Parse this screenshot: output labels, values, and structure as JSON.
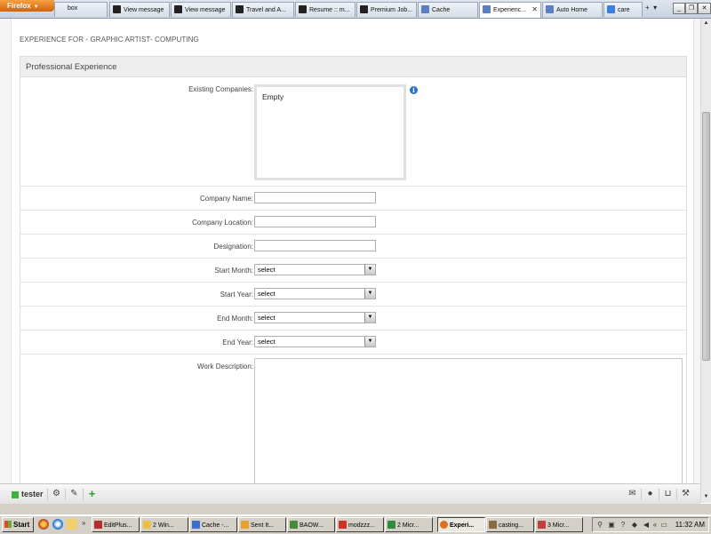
{
  "browser": {
    "menu_button": "Firefox",
    "tabs": [
      {
        "label": "box",
        "icon": "mail-icon",
        "color": "#6a8fc6"
      },
      {
        "label": "View message",
        "icon": "infinity-icon",
        "color": "#222222"
      },
      {
        "label": "View message",
        "icon": "infinity-icon",
        "color": "#222222"
      },
      {
        "label": "Travel and A...",
        "icon": "infinity-icon",
        "color": "#222222"
      },
      {
        "label": "Resume :: m...",
        "icon": "infinity-icon",
        "color": "#222222"
      },
      {
        "label": "Premium Job...",
        "icon": "infinity-icon",
        "color": "#222222"
      },
      {
        "label": "Cache",
        "icon": "page-icon",
        "color": "#5b7fc0"
      },
      {
        "label": "Experienc...",
        "icon": "page-icon",
        "color": "#5b7fc0",
        "active": true
      },
      {
        "label": "Auto Home",
        "icon": "page-icon",
        "color": "#5b7fc0"
      },
      {
        "label": "care",
        "icon": "google-icon",
        "color": "#3b7de0"
      }
    ]
  },
  "page": {
    "title": "EXPERIENCE FOR - GRAPHIC ARTIST- COMPUTING",
    "section_title": "Professional Experience",
    "existing_companies": {
      "label": "Existing Companies:",
      "value": "Empty"
    },
    "fields": {
      "company_name": {
        "label": "Company Name:",
        "value": ""
      },
      "company_location": {
        "label": "Company Location:",
        "value": ""
      },
      "designation": {
        "label": "Designation:",
        "value": ""
      },
      "start_month": {
        "label": "Start Month:",
        "value": "select"
      },
      "start_year": {
        "label": "Start Year:",
        "value": "select"
      },
      "end_month": {
        "label": "End Month:",
        "value": "select"
      },
      "end_year": {
        "label": "End Year:",
        "value": "select"
      },
      "work_description": {
        "label": "Work Description:",
        "value": ""
      }
    }
  },
  "site_toolbar": {
    "user": "tester",
    "left_icons": [
      "gear-icon",
      "edit-icon",
      "plus-icon"
    ],
    "right_icons": [
      "mail-icon",
      "user-icon",
      "cart-icon",
      "wrench-icon"
    ],
    "plus_color": "#2a9d2a"
  },
  "taskbar": {
    "start_label": "Start",
    "tasks": [
      {
        "label": "EditPlus...",
        "color": "#b03030"
      },
      {
        "label": "2 Win...",
        "color": "#e8c04a"
      },
      {
        "label": "Cache -...",
        "color": "#3a70c8"
      },
      {
        "label": "Sent It...",
        "color": "#e8a030"
      },
      {
        "label": "BAOW...",
        "color": "#4a8a3a"
      },
      {
        "label": "modzzz...",
        "color": "#cc3322"
      },
      {
        "label": "2 Micr...",
        "color": "#2f8a3a"
      },
      {
        "label": "Experi...",
        "color": "#e07020",
        "active": true
      },
      {
        "label": "casting...",
        "color": "#8a6a40"
      },
      {
        "label": "3 Micr...",
        "color": "#c04040"
      }
    ],
    "clock": "11:32 AM"
  }
}
